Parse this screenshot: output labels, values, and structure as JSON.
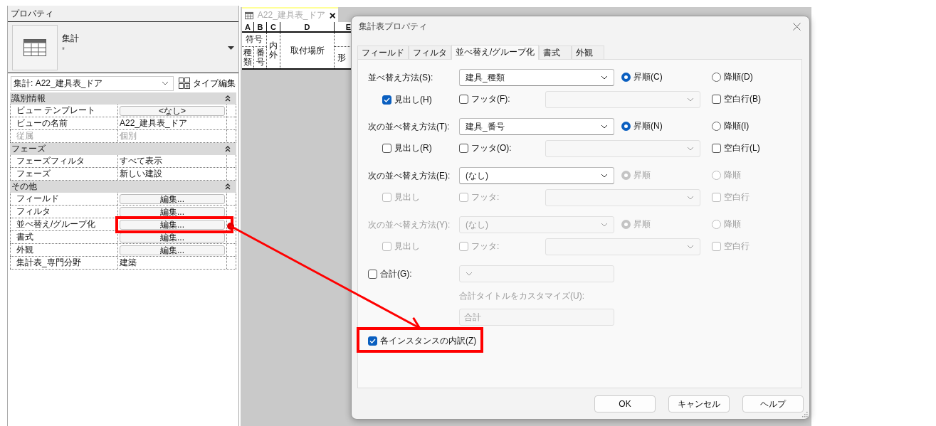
{
  "properties_panel": {
    "title": "プロパティ",
    "type_name": "集計",
    "type_mark": "*",
    "view_selector": "集計: A22_建具表_ドア",
    "type_edit_button": "タイプ編集",
    "sections": [
      {
        "title": "識別情報",
        "expanded": true,
        "rows": [
          {
            "label": "ビュー テンプレート",
            "value": "<なし>",
            "kind": "button",
            "disabled": false
          },
          {
            "label": "ビューの名前",
            "value": "A22_建具表_ドア",
            "kind": "text",
            "disabled": false
          },
          {
            "label": "従属",
            "value": "個別",
            "kind": "text",
            "disabled": true
          }
        ]
      },
      {
        "title": "フェーズ",
        "expanded": true,
        "rows": [
          {
            "label": "フェーズフィルタ",
            "value": "すべて表示",
            "kind": "text",
            "disabled": false
          },
          {
            "label": "フェーズ",
            "value": "新しい建設",
            "kind": "text",
            "disabled": false
          }
        ]
      },
      {
        "title": "その他",
        "expanded": true,
        "rows": [
          {
            "label": "フィールド",
            "value": "編集...",
            "kind": "button",
            "disabled": false
          },
          {
            "label": "フィルタ",
            "value": "編集...",
            "kind": "button",
            "disabled": false
          },
          {
            "label": "並べ替え/グループ化",
            "value": "編集...",
            "kind": "button",
            "disabled": false
          },
          {
            "label": "書式",
            "value": "編集...",
            "kind": "button",
            "disabled": false
          },
          {
            "label": "外観",
            "value": "編集...",
            "kind": "button",
            "disabled": false
          },
          {
            "label": "集計表_専門分野",
            "value": "建築",
            "kind": "text",
            "disabled": false
          }
        ]
      }
    ]
  },
  "schedule_view": {
    "tab_title": "A22_建具表_ドア",
    "column_letters": [
      "A",
      "B",
      "C",
      "D",
      "E"
    ],
    "group_heading": "符号",
    "sub_headings": [
      "種類",
      "番号"
    ],
    "other_headings": [
      "内外",
      "取付場所",
      "形"
    ]
  },
  "dialog": {
    "title": "集計表プロパティ",
    "tabs": [
      {
        "label": "フィールド",
        "selected": false
      },
      {
        "label": "フィルタ",
        "selected": false
      },
      {
        "label": "並べ替え/グループ化",
        "selected": true
      },
      {
        "label": "書式",
        "selected": false
      },
      {
        "label": "外観",
        "selected": false
      }
    ],
    "sort_levels": [
      {
        "label": "並べ替え方法(S):",
        "value": "建具_種類",
        "enabled": true,
        "options_enabled": true,
        "orders": [
          {
            "label": "昇順(C)",
            "selected": true
          },
          {
            "label": "降順(D)",
            "selected": false
          }
        ],
        "header": {
          "label": "見出し(H)",
          "checked": true
        },
        "footer": {
          "label": "フッタ(F):",
          "checked": false
        },
        "blank_line": {
          "label": "空白行(B)",
          "checked": false
        }
      },
      {
        "label": "次の並べ替え方法(T):",
        "value": "建具_番号",
        "enabled": true,
        "options_enabled": true,
        "orders": [
          {
            "label": "昇順(N)",
            "selected": true
          },
          {
            "label": "降順(I)",
            "selected": false
          }
        ],
        "header": {
          "label": "見出し(R)",
          "checked": false
        },
        "footer": {
          "label": "フッタ(O):",
          "checked": false
        },
        "blank_line": {
          "label": "空白行(L)",
          "checked": false
        }
      },
      {
        "label": "次の並べ替え方法(E):",
        "value": "(なし)",
        "enabled": true,
        "options_enabled": false,
        "orders": [
          {
            "label": "昇順",
            "selected": true
          },
          {
            "label": "降順",
            "selected": false
          }
        ],
        "header": {
          "label": "見出し",
          "checked": false
        },
        "footer": {
          "label": "フッタ:",
          "checked": false
        },
        "blank_line": {
          "label": "空白行",
          "checked": false
        }
      },
      {
        "label": "次の並べ替え方法(Y):",
        "value": "(なし)",
        "enabled": false,
        "options_enabled": false,
        "orders": [
          {
            "label": "昇順",
            "selected": true
          },
          {
            "label": "降順",
            "selected": false
          }
        ],
        "header": {
          "label": "見出し",
          "checked": false
        },
        "footer": {
          "label": "フッタ:",
          "checked": false
        },
        "blank_line": {
          "label": "空白行",
          "checked": false
        }
      }
    ],
    "grand_total": {
      "label": "合計(G):",
      "checked": false
    },
    "custom_title": {
      "label": "合計タイトルをカスタマイズ(U):",
      "value": "合計",
      "disabled": true
    },
    "itemize": {
      "label": "各インスタンスの内訳(Z)",
      "checked": true
    },
    "buttons": [
      "OK",
      "キャンセル",
      "ヘルプ"
    ]
  }
}
